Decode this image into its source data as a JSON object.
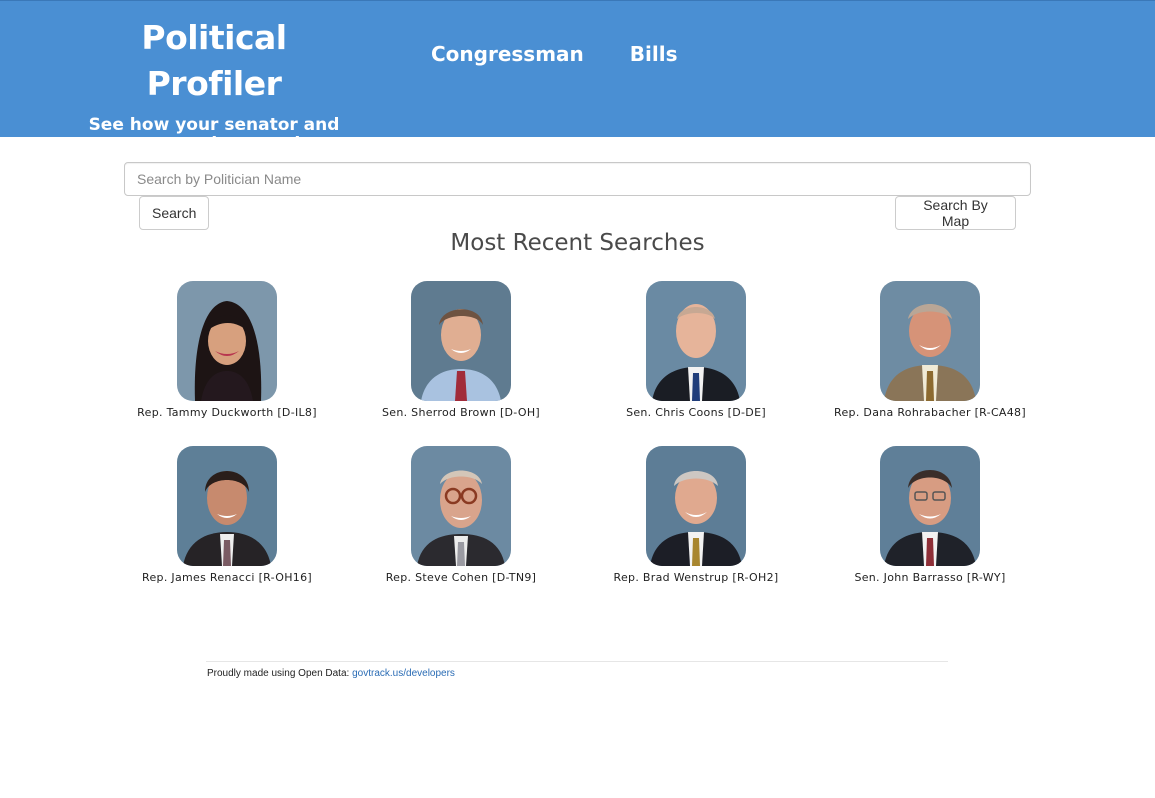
{
  "header": {
    "title": "Political Profiler",
    "subtitle": "See how your senator and representative voted on issues important to you!",
    "nav": [
      {
        "label": "Congressman"
      },
      {
        "label": "Bills"
      }
    ]
  },
  "search": {
    "placeholder": "Search by Politician Name",
    "value": "",
    "search_button": "Search",
    "map_button": "Search By Map"
  },
  "recent": {
    "title": "Most Recent Searches",
    "people": [
      {
        "name": "Rep. Tammy Duckworth [D-IL8]"
      },
      {
        "name": "Sen. Sherrod Brown [D-OH]"
      },
      {
        "name": "Sen. Chris Coons [D-DE]"
      },
      {
        "name": "Rep. Dana Rohrabacher [R-CA48]"
      },
      {
        "name": "Rep. James Renacci [R-OH16]"
      },
      {
        "name": "Rep. Steve Cohen [D-TN9]"
      },
      {
        "name": "Rep. Brad Wenstrup [R-OH2]"
      },
      {
        "name": "Sen. John Barrasso [R-WY]"
      }
    ]
  },
  "footer": {
    "text": "Proudly made using Open Data:",
    "link": "govtrack.us/developers"
  },
  "colors": {
    "header_bg": "#4a8fd3",
    "link": "#2a6cb5"
  }
}
